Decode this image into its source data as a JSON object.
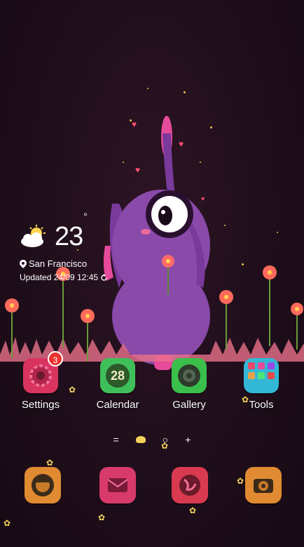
{
  "weather": {
    "temperature": "23",
    "unit": "°",
    "location": "San Francisco",
    "updated": "Updated 24/09 12:45"
  },
  "apps": [
    {
      "label": "Settings",
      "icon": "gear-icon",
      "badge": "3",
      "color": "#d9345f"
    },
    {
      "label": "Calendar",
      "icon": "calendar-icon",
      "day": "28",
      "color": "#3fbf5a"
    },
    {
      "label": "Gallery",
      "icon": "camera-lens-icon",
      "color": "#3bbf4b"
    },
    {
      "label": "Tools",
      "icon": "grid-icon",
      "color": "#33b7d6"
    }
  ],
  "pager": {
    "left": "=",
    "dot": "○",
    "add": "+"
  },
  "dock": [
    {
      "name": "phone",
      "icon": "phone-icon",
      "color": "#e08a31"
    },
    {
      "name": "messages",
      "icon": "envelope-icon",
      "color": "#d83a6b"
    },
    {
      "name": "browser",
      "icon": "globe-icon",
      "color": "#d83a4f"
    },
    {
      "name": "camera",
      "icon": "camera-icon",
      "color": "#e08a31"
    }
  ]
}
